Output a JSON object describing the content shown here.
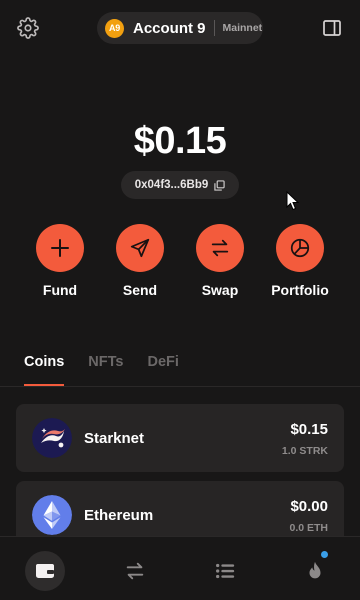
{
  "header": {
    "settings_icon": "gear-icon",
    "account": {
      "avatar_initials": "A9",
      "avatar_color": "#f2a010",
      "name": "Account 9",
      "network": "Mainnet"
    },
    "panel_icon": "sidebar-panel-icon"
  },
  "wallet": {
    "balance": "$0.15",
    "address": "0x04f3...6Bb9"
  },
  "actions": [
    {
      "label": "Fund",
      "icon": "plus-icon"
    },
    {
      "label": "Send",
      "icon": "send-icon"
    },
    {
      "label": "Swap",
      "icon": "swap-icon"
    },
    {
      "label": "Portfolio",
      "icon": "pie-chart-icon"
    }
  ],
  "tabs": [
    {
      "label": "Coins",
      "active": true
    },
    {
      "label": "NFTs",
      "active": false
    },
    {
      "label": "DeFi",
      "active": false
    }
  ],
  "tokens": [
    {
      "name": "Starknet",
      "value": "$0.15",
      "amount": "1.0 STRK",
      "icon": "starknet-logo-icon"
    },
    {
      "name": "Ethereum",
      "value": "$0.00",
      "amount": "0.0 ETH",
      "icon": "ethereum-logo-icon"
    }
  ],
  "bottom_nav": [
    {
      "name": "wallet",
      "icon": "wallet-icon",
      "active": true
    },
    {
      "name": "activity",
      "icon": "transfer-arrows-icon",
      "active": false
    },
    {
      "name": "list",
      "icon": "list-icon",
      "active": false
    },
    {
      "name": "ecosystem",
      "icon": "flame-icon",
      "active": false,
      "notification": true
    }
  ],
  "colors": {
    "accent": "#f35b3c",
    "background": "#181717",
    "card": "#272525",
    "notification": "#3a9fe8"
  }
}
